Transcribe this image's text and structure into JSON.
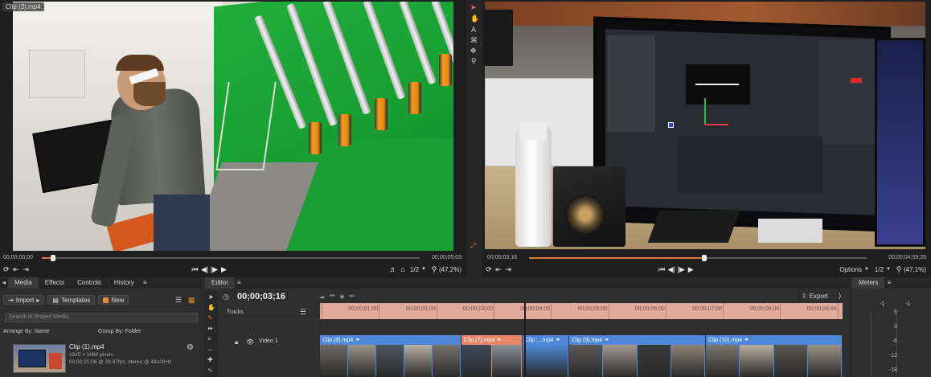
{
  "left_viewer": {
    "clip_label": "Clip (3).mp4",
    "timecode_current": "00;00;00;00",
    "timecode_duration": "00;00;05;03",
    "ratio": "1/2",
    "zoom": "(47,2%)",
    "progress": 0.03
  },
  "right_viewer": {
    "timecode_current": "00;00;03;16",
    "timecode_duration": "00;00;04;59;29",
    "options_label": "Options",
    "ratio": "1/2",
    "zoom": "(47,1%)",
    "progress": 0.52
  },
  "left_panel": {
    "tabs": [
      "Media",
      "Effects",
      "Controls",
      "History"
    ],
    "import_label": "Import",
    "templates_label": "Templates",
    "new_label": "New",
    "search_placeholder": "Search in Project Media",
    "arrange_label": "Arrange By: Name",
    "group_label": "Group By: Folder",
    "media_item": {
      "name": "Clip (1).mp4",
      "resolution": "1920 × 1080 pixels",
      "info": "00;00;21;06 @ 29.97fps, stereo @ 44100Hz"
    }
  },
  "editor": {
    "tab_label": "Editor",
    "timecode": "00;00;03;16",
    "export_label": "Export",
    "tracks_label": "Tracks",
    "track_name": "Video 1",
    "ruler_labels": [
      "00;00;01;00",
      "00;00;02;00",
      "00;00;03;00",
      "00;00;04;00",
      "00;00;05;00",
      "00;00;06;00",
      "00;00;07;00",
      "00;00;08;00",
      "00;00;09;00"
    ],
    "clips": [
      {
        "label": "Clip (8).mp4"
      },
      {
        "label": "Clip (7).mp4"
      },
      {
        "label": "Clip ....mp4"
      },
      {
        "label": "Clip (9).mp4"
      },
      {
        "label": "Clip (10).mp4"
      }
    ]
  },
  "meters": {
    "tab_label": "Meters",
    "channel_tops": [
      "-1",
      "-1"
    ],
    "scale": [
      "6",
      "0",
      "-6",
      "-12",
      "-18"
    ]
  },
  "colors": {
    "accent": "#e07a3c",
    "clip_blue": "#4f88d8",
    "clip_salmon": "#e8876a",
    "ruler": "#e2a99d"
  }
}
